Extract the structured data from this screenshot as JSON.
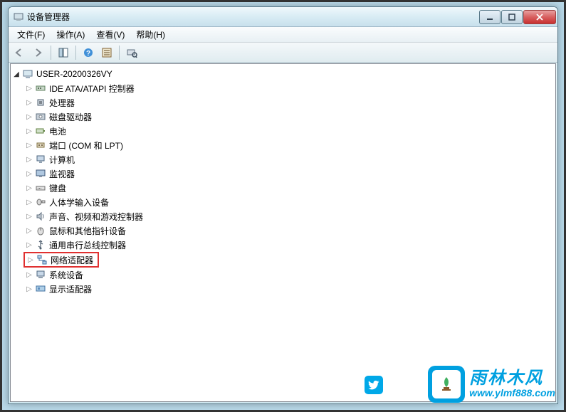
{
  "window": {
    "title": "设备管理器"
  },
  "menu": {
    "file": "文件(F)",
    "action": "操作(A)",
    "view": "查看(V)",
    "help": "帮助(H)"
  },
  "tree": {
    "root": "USER-20200326VY",
    "items": [
      "IDE ATA/ATAPI 控制器",
      "处理器",
      "磁盘驱动器",
      "电池",
      "端口 (COM 和 LPT)",
      "计算机",
      "监视器",
      "键盘",
      "人体学输入设备",
      "声音、视频和游戏控制器",
      "鼠标和其他指针设备",
      "通用串行总线控制器",
      "网络适配器",
      "系统设备",
      "显示适配器"
    ]
  },
  "watermark": {
    "cn": "雨林木风",
    "url": "www.ylmf888.com"
  }
}
